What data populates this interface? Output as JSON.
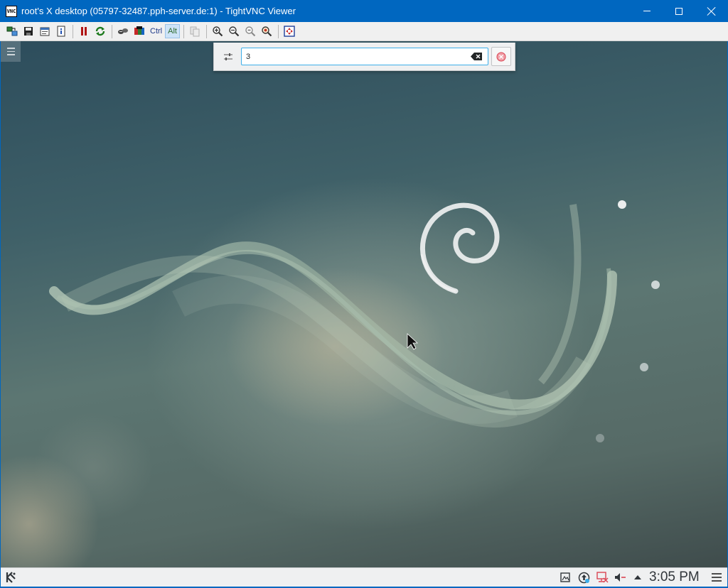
{
  "window": {
    "title": "root's X desktop (05797-32487.pph-server.de:1) - TightVNC Viewer",
    "icon_text": "VNC",
    "controls": [
      "minimize-icon",
      "maximize-icon",
      "close-icon"
    ]
  },
  "toolbar": {
    "items": [
      {
        "name": "new-connection-icon"
      },
      {
        "name": "save-icon"
      },
      {
        "name": "options-icon"
      },
      {
        "name": "connection-info-icon"
      },
      {
        "name": "pause-icon"
      },
      {
        "name": "refresh-icon"
      },
      {
        "name": "ctrl-alt-del-icon"
      },
      {
        "name": "ctrl-esc-icon"
      }
    ],
    "ctrl_label": "Ctrl",
    "alt_label": "Alt",
    "zoom_icons": [
      "zoom-in-icon",
      "zoom-out-icon",
      "zoom-100-icon",
      "zoom-auto-icon"
    ],
    "fullscreen_icon": "fullscreen-icon"
  },
  "krunner": {
    "input_value": "3",
    "config_icon": "configure-icon",
    "clear_icon": "clear-text-icon",
    "close_icon": "close-circle-icon"
  },
  "desktop": {
    "colors": {
      "background_dark": "#2d4d5c",
      "swirl": "#a9bfae",
      "logo": "#eef0f0"
    }
  },
  "taskbar": {
    "launcher_icon": "kde-logo-icon",
    "tray_icons": [
      "clipboard-icon",
      "updates-icon",
      "network-disconnected-icon",
      "volume-icon",
      "expand-tray-icon"
    ],
    "clock": "3:05 PM"
  }
}
